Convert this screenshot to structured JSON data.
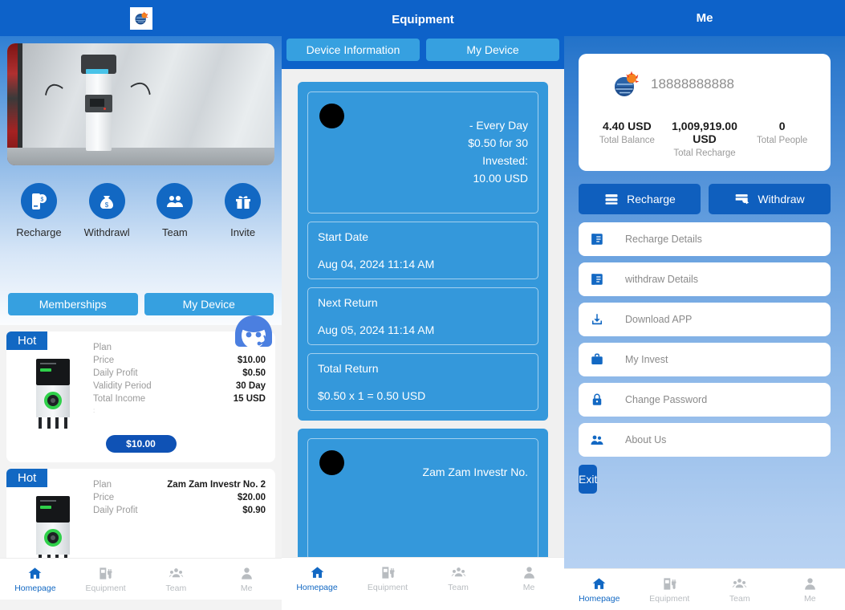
{
  "panel1": {
    "header": {
      "logo_icon": "app-logo-icon"
    },
    "hero": {
      "alt": "ev-charging-station-photo"
    },
    "quick_actions": [
      {
        "label": "Recharge",
        "icon": "mobile-money-icon"
      },
      {
        "label": "Withdrawl",
        "icon": "money-bag-icon"
      },
      {
        "label": "Team",
        "icon": "people-icon"
      },
      {
        "label": "Invite",
        "icon": "gift-icon"
      }
    ],
    "tabs": [
      {
        "label": "Memberships",
        "active": true
      },
      {
        "label": "My Device",
        "active": false
      }
    ],
    "products": [
      {
        "badge": "Hot",
        "rows": [
          {
            "key": "Plan",
            "value": ""
          },
          {
            "key": "Price",
            "value": "$10.00"
          },
          {
            "key": "Daily Profit",
            "value": "$0.50"
          },
          {
            "key": "Validity Period",
            "value": "30 Day"
          },
          {
            "key": "Total Income",
            "value": "15 USD"
          }
        ],
        "note": ":",
        "buy_label": "$10.00"
      },
      {
        "badge": "Hot",
        "rows": [
          {
            "key": "Plan",
            "value": "Zam Zam Investr No. 2"
          },
          {
            "key": "Price",
            "value": "$20.00"
          },
          {
            "key": "Daily Profit",
            "value": "$0.90"
          }
        ],
        "note": "",
        "buy_label": ""
      }
    ],
    "chat_widget": {
      "icon": "customer-service-avatar-icon"
    },
    "nav": [
      {
        "label": "Homepage",
        "icon": "home-icon",
        "active": true
      },
      {
        "label": "Equipment",
        "icon": "charger-icon",
        "active": false
      },
      {
        "label": "Team",
        "icon": "team-icon",
        "active": false
      },
      {
        "label": "Me",
        "icon": "person-icon",
        "active": false
      }
    ]
  },
  "panel2": {
    "title": "Equipment",
    "tabs": [
      {
        "label": "Device Information",
        "active": true
      },
      {
        "label": "My Device",
        "active": false
      }
    ],
    "cards": [
      {
        "thumb_icon": "device-thumb-icon",
        "summary": "- Every Day $0.50 for 30 Invested: 10.00 USD",
        "summary_lines": [
          "- Every Day",
          "$0.50 for 30",
          "Invested:",
          "10.00 USD"
        ],
        "fields": [
          {
            "label": "Start Date",
            "value": "Aug 04, 2024 11:14 AM"
          },
          {
            "label": "Next Return",
            "value": "Aug 05, 2024 11:14 AM"
          },
          {
            "label": "Total Return",
            "value": "$0.50 x 1 = 0.50 USD"
          }
        ]
      },
      {
        "thumb_icon": "device-thumb-icon",
        "summary_lines": [
          "Zam Zam Investr No."
        ],
        "fields": []
      }
    ],
    "nav": [
      {
        "label": "Homepage",
        "icon": "home-icon",
        "active": true
      },
      {
        "label": "Equipment",
        "icon": "charger-icon",
        "active": false
      },
      {
        "label": "Team",
        "icon": "team-icon",
        "active": false
      },
      {
        "label": "Me",
        "icon": "person-icon",
        "active": false
      }
    ]
  },
  "panel3": {
    "title": "Me",
    "profile": {
      "avatar_icon": "app-logo-icon",
      "phone": "18888888888",
      "stats": [
        {
          "value": "4.40 USD",
          "label": "Total Balance"
        },
        {
          "value": "1,009,919.00 USD",
          "label": "Total Recharge"
        },
        {
          "value": "0",
          "label": "Total People"
        }
      ]
    },
    "actions": [
      {
        "label": "Recharge",
        "icon": "stacked-cards-icon"
      },
      {
        "label": "Withdraw",
        "icon": "card-transfer-icon"
      }
    ],
    "menu": [
      {
        "label": "Recharge Details",
        "icon": "list-card-icon"
      },
      {
        "label": "withdraw Details",
        "icon": "list-card-icon"
      },
      {
        "label": "Download APP",
        "icon": "download-icon"
      },
      {
        "label": "My Invest",
        "icon": "briefcase-icon"
      },
      {
        "label": "Change Password",
        "icon": "lock-icon"
      },
      {
        "label": "About Us",
        "icon": "users-icon"
      }
    ],
    "exit_label": "Exit",
    "nav": [
      {
        "label": "Homepage",
        "icon": "home-icon",
        "active": true
      },
      {
        "label": "Equipment",
        "icon": "charger-icon",
        "active": false
      },
      {
        "label": "Team",
        "icon": "team-icon",
        "active": false
      },
      {
        "label": "Me",
        "icon": "person-icon",
        "active": false
      }
    ]
  },
  "colors": {
    "header_blue": "#0d62c9",
    "tab_blue": "#36a0e0",
    "card_blue": "#3498db",
    "accent_blue": "#1268c3",
    "button_blue": "#0f52b5",
    "muted_text": "#9a9a9a"
  }
}
